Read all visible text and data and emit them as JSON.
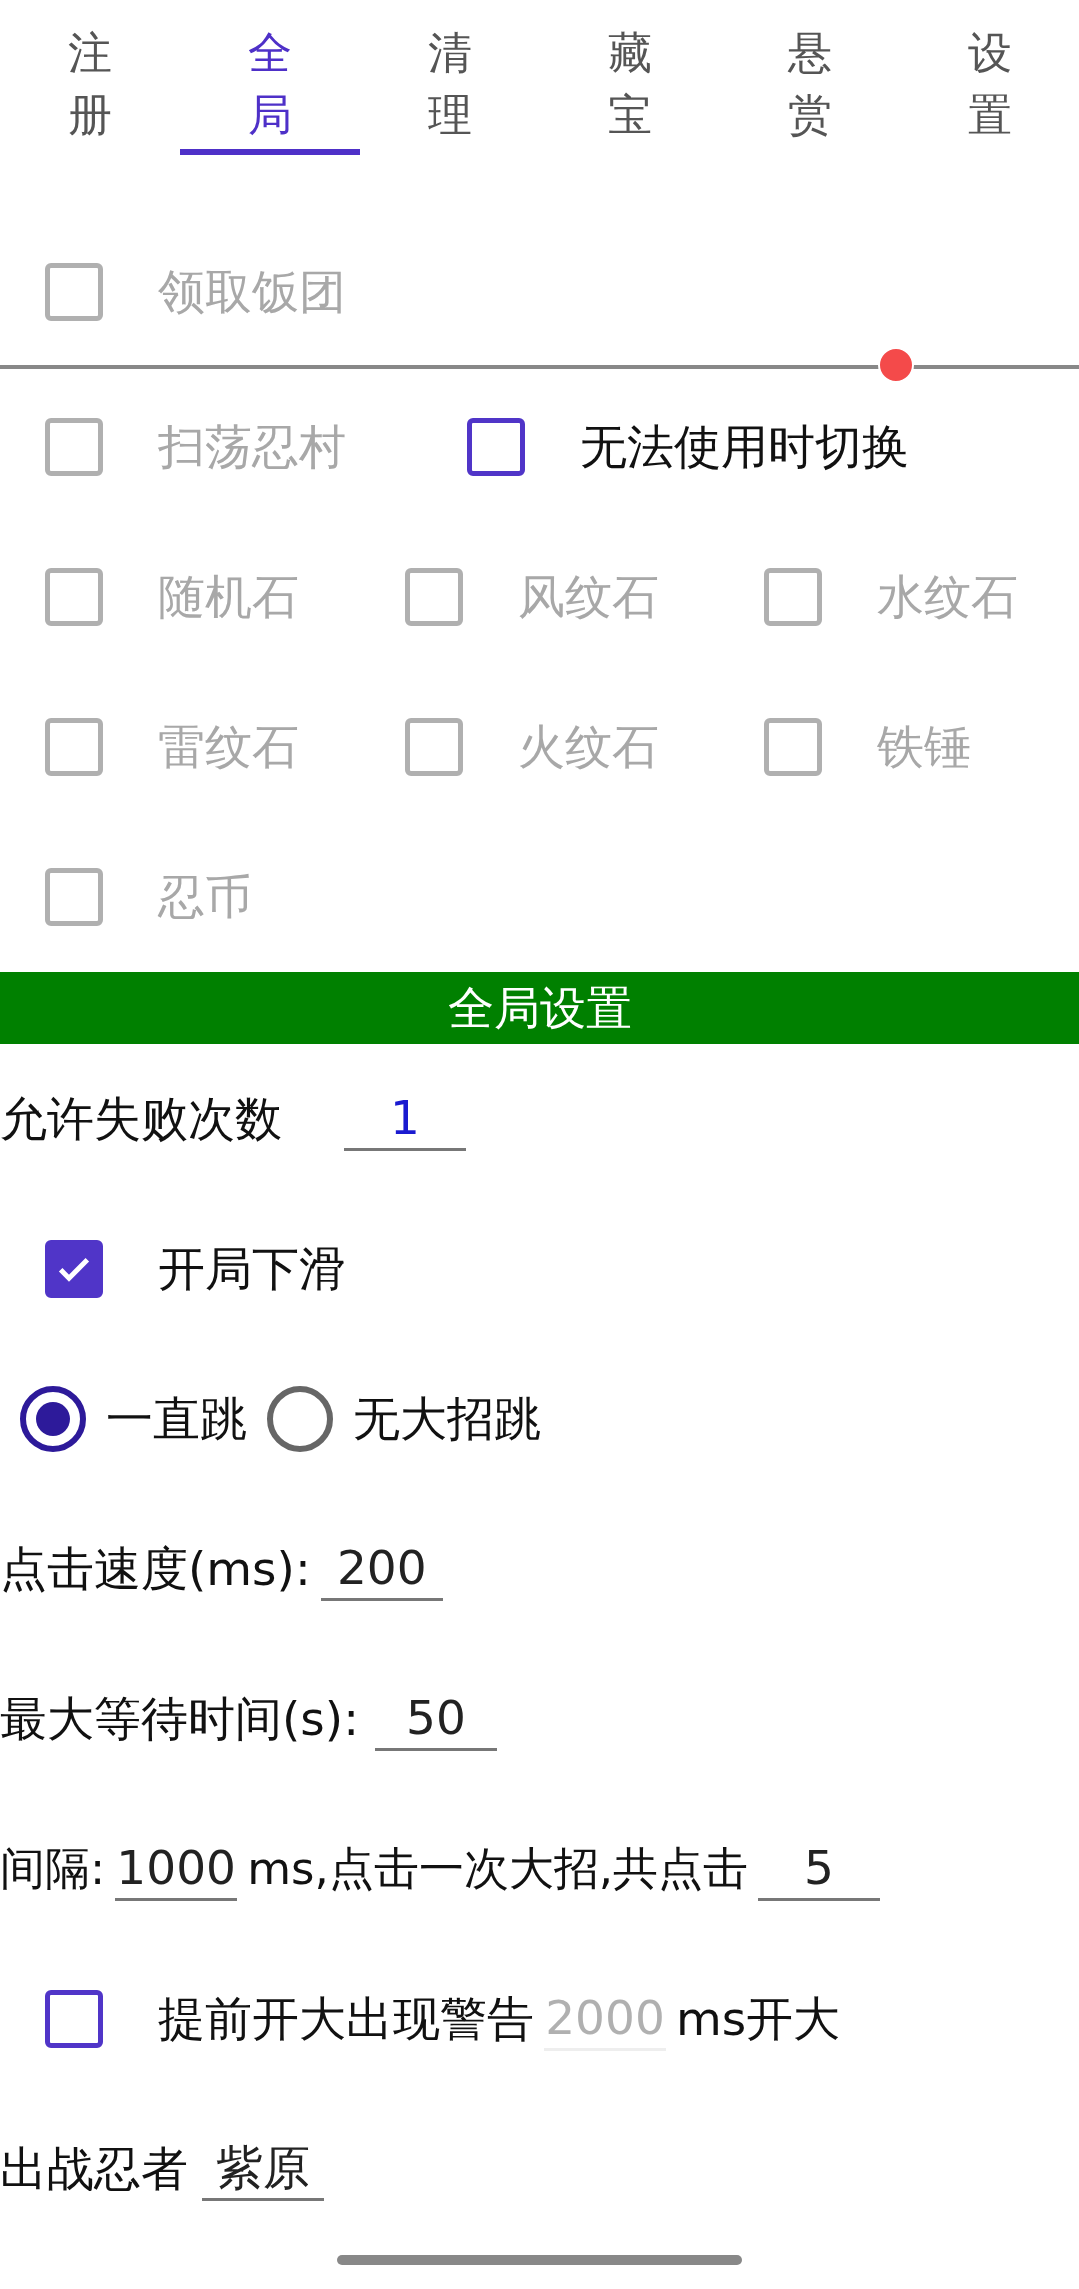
{
  "tabs": [
    {
      "label": "注册",
      "selected": false
    },
    {
      "label": "全局",
      "selected": true
    },
    {
      "label": "清理",
      "selected": false
    },
    {
      "label": "藏宝",
      "selected": false
    },
    {
      "label": "悬赏",
      "selected": false
    },
    {
      "label": "设置",
      "selected": false
    }
  ],
  "options_top": [
    {
      "label": "领取饭团",
      "checked": false,
      "disabled": true
    }
  ],
  "slider": {
    "level": 0.83
  },
  "options": [
    [
      {
        "label": "扫荡忍村",
        "checked": false,
        "disabled": true
      },
      {
        "label": "无法使用时切换",
        "checked": false,
        "disabled": false
      }
    ],
    [
      {
        "label": "随机石",
        "checked": false,
        "disabled": true
      },
      {
        "label": "风纹石",
        "checked": false,
        "disabled": true
      },
      {
        "label": "水纹石",
        "checked": false,
        "disabled": true
      }
    ],
    [
      {
        "label": "雷纹石",
        "checked": false,
        "disabled": true
      },
      {
        "label": "火纹石",
        "checked": false,
        "disabled": true
      },
      {
        "label": "铁锤",
        "checked": false,
        "disabled": true
      }
    ],
    [
      {
        "label": "忍币",
        "checked": false,
        "disabled": true
      }
    ]
  ],
  "section_title": "全局设置",
  "fail_count": {
    "label": "允许失败次数",
    "value": "1"
  },
  "slide_down": {
    "label": "开局下滑",
    "checked": true
  },
  "jump_mode": [
    {
      "label": "一直跳",
      "selected": true
    },
    {
      "label": "无大招跳",
      "selected": false
    }
  ],
  "click_speed": {
    "label": "点击速度(ms):",
    "value": "200"
  },
  "max_wait": {
    "label": "最大等待时间(s):",
    "value": "50"
  },
  "interval": {
    "label": "间隔:",
    "value": "1000",
    "middle": "ms,点击一次大招,共点击",
    "count": "5"
  },
  "warning": {
    "label": "提前开大出现警告",
    "checked": false,
    "value": "2000",
    "disabled": true,
    "suffix": "ms开大"
  },
  "ninja": {
    "label": "出战忍者",
    "value": "紫原"
  }
}
